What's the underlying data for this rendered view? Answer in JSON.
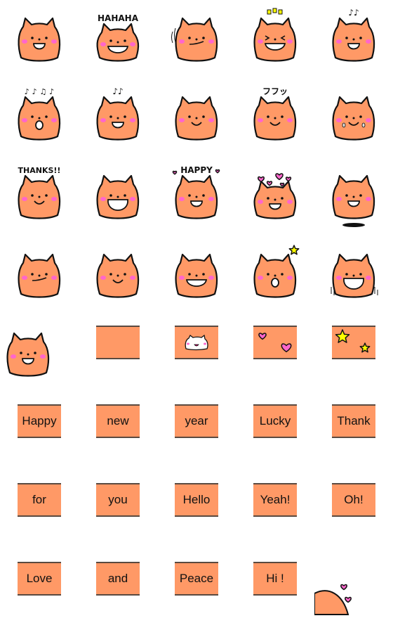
{
  "colors": {
    "body": "#ff9966",
    "outline": "#111111",
    "cheek": "#ff66cc",
    "heart": "#ff66cc",
    "star": "#ffff00",
    "tile_border": "#5a4a40"
  },
  "stickers": [
    {
      "kind": "cat",
      "mouth": "open"
    },
    {
      "kind": "cat",
      "mouth": "grin",
      "flat": true,
      "caption": "HAHAHA"
    },
    {
      "kind": "cat",
      "mouth": "smirk",
      "extra": "wave-lines"
    },
    {
      "kind": "cat",
      "mouth": "grin",
      "eyes": "squint",
      "extra": "sparkle"
    },
    {
      "kind": "cat",
      "mouth": "open",
      "caption": "♪♪"
    },
    {
      "kind": "cat",
      "mouth": "o",
      "caption": "♪ ♪ ♫ ♪"
    },
    {
      "kind": "cat",
      "mouth": "open",
      "caption": "♪♪"
    },
    {
      "kind": "cat",
      "mouth": "smile"
    },
    {
      "kind": "cat",
      "mouth": "smile",
      "caption": "フフッ"
    },
    {
      "kind": "cat",
      "mouth": "smile",
      "extra": "tears"
    },
    {
      "kind": "cat",
      "mouth": "smile",
      "caption": "THANKS!!"
    },
    {
      "kind": "cat",
      "mouth": "huge"
    },
    {
      "kind": "cat",
      "mouth": "open",
      "caption": "HAPPY",
      "extra": "small-hearts"
    },
    {
      "kind": "cat",
      "mouth": "open",
      "flat": true,
      "extra": "hearts"
    },
    {
      "kind": "cat",
      "mouth": "open",
      "extra": "jump"
    },
    {
      "kind": "cat",
      "mouth": "smirk"
    },
    {
      "kind": "cat",
      "mouth": "smile"
    },
    {
      "kind": "cat",
      "mouth": "grin"
    },
    {
      "kind": "cat",
      "mouth": "o",
      "extra": "star"
    },
    {
      "kind": "cat",
      "mouth": "huge",
      "extra": "shake"
    },
    {
      "kind": "cat",
      "mouth": "open",
      "extra": "peek"
    },
    {
      "kind": "tile",
      "label": ""
    },
    {
      "kind": "tile",
      "label": "",
      "icon": "white-cat"
    },
    {
      "kind": "tile",
      "label": "",
      "icon": "hearts"
    },
    {
      "kind": "tile",
      "label": "",
      "icon": "stars"
    },
    {
      "kind": "tile",
      "label": "Happy"
    },
    {
      "kind": "tile",
      "label": "new"
    },
    {
      "kind": "tile",
      "label": "year"
    },
    {
      "kind": "tile",
      "label": "Lucky"
    },
    {
      "kind": "tile",
      "label": "Thank"
    },
    {
      "kind": "tile",
      "label": "for"
    },
    {
      "kind": "tile",
      "label": "you"
    },
    {
      "kind": "tile",
      "label": "Hello"
    },
    {
      "kind": "tile",
      "label": "Yeah!"
    },
    {
      "kind": "tile",
      "label": "Oh!"
    },
    {
      "kind": "tile",
      "label": "Love"
    },
    {
      "kind": "tile",
      "label": "and"
    },
    {
      "kind": "tile",
      "label": "Peace"
    },
    {
      "kind": "tile",
      "label": "Hi !"
    },
    {
      "kind": "cat",
      "extra": "corner-hearts"
    }
  ]
}
